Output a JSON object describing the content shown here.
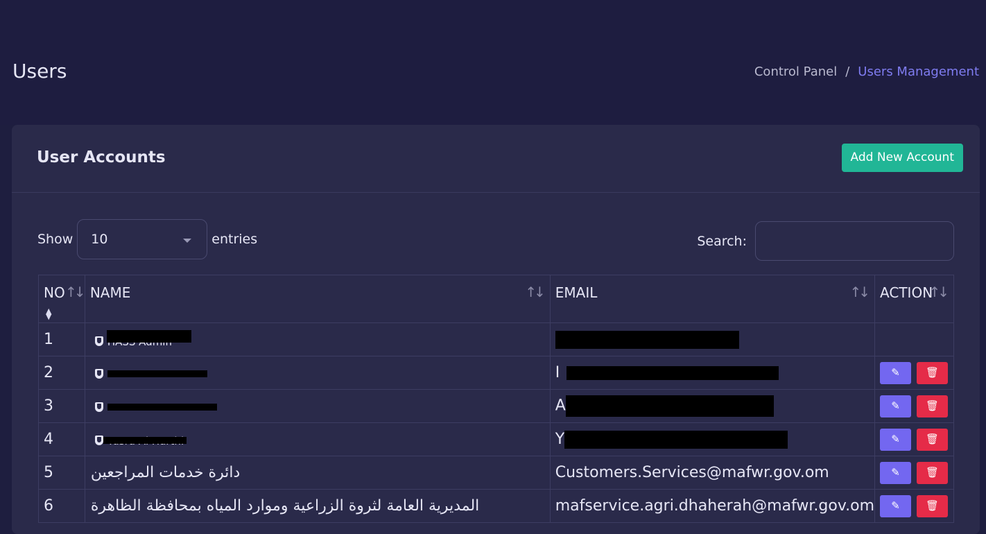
{
  "page": {
    "title": "Users"
  },
  "breadcrumb": {
    "home": "Control Panel",
    "separator": "/",
    "current": "Users Management"
  },
  "card": {
    "title": "User Accounts",
    "add_button": "Add New Account"
  },
  "controls": {
    "show_label": "Show",
    "page_length": "10",
    "entries_label": "entries",
    "search_label": "Search:",
    "search_value": ""
  },
  "table": {
    "headers": {
      "no": "NO",
      "name": "NAME",
      "email": "EMAIL",
      "action": "ACTION"
    },
    "rows": [
      {
        "no": "1",
        "name": "HASS Admin",
        "name_shield": true,
        "email": ""
      },
      {
        "no": "2",
        "name": "",
        "name_shield": true,
        "email": "I"
      },
      {
        "no": "3",
        "name": "",
        "name_shield": true,
        "email": "A"
      },
      {
        "no": "4",
        "name": "Yusra Al Harthi",
        "name_shield": true,
        "email": "Y"
      },
      {
        "no": "5",
        "name": "دائرة خدمات المراجعين",
        "name_shield": false,
        "email": "Customers.Services@mafwr.gov.om"
      },
      {
        "no": "6",
        "name": "المديرية العامة لثروة الزراعية وموارد المياه بمحافظة الظاهرة",
        "name_shield": false,
        "email": "mafservice.agri.dhaherah@mafwr.gov.om"
      }
    ]
  },
  "colors": {
    "accent": "#7f7cf0",
    "add_button": "#21b696",
    "edit_button": "#7367f0",
    "delete_button": "#e52b48"
  },
  "icons": {
    "edit": "edit-icon",
    "delete": "trash-icon",
    "sort": "sort-icon",
    "user_type": "shield-icon"
  }
}
